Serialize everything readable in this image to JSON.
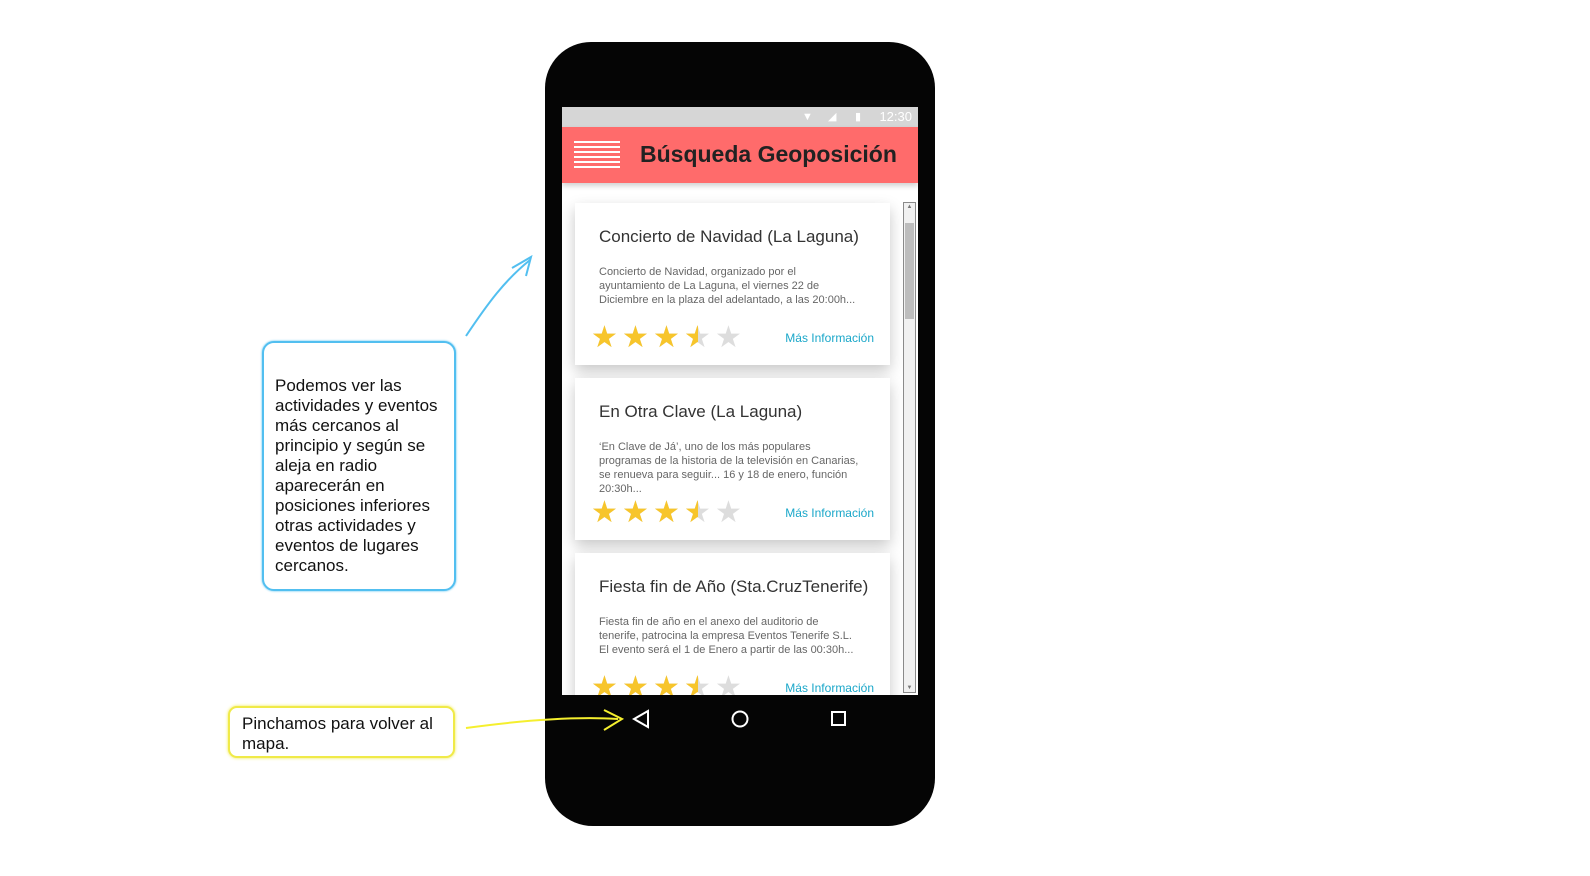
{
  "status_bar": {
    "time": "12:30",
    "icons": [
      "wifi-icon",
      "signal-icon",
      "battery-icon"
    ]
  },
  "app_bar": {
    "title": "Búsqueda Geoposición",
    "menu_icon": "hamburger-menu-icon",
    "color": "#ff6b6b"
  },
  "events": [
    {
      "title": "Concierto de Navidad (La Laguna)",
      "description": "Concierto de Navidad, organizado por el ayuntamiento de La Laguna, el viernes 22 de Diciembre en la plaza del adelantado, a las 20:00h...",
      "rating": 3.5,
      "rating_max": 5,
      "link": "Más Información"
    },
    {
      "title": "En Otra Clave (La Laguna)",
      "description": "‘En Clave de Já’, uno de los más populares programas de la historia de la televisión en Canarias, se renueva para seguir... 16 y 18 de enero, función 20:30h...",
      "rating": 3.5,
      "rating_max": 5,
      "link": "Más Información"
    },
    {
      "title": "Fiesta fin de Año (Sta.CruzTenerife)",
      "description": "Fiesta fin de año en el anexo del auditorio de tenerife, patrocina la empresa Eventos Tenerife S.L. El evento será el 1 de Enero a partir de las 00:30h...",
      "rating": 3.5,
      "rating_max": 5,
      "link": "Más Información"
    }
  ],
  "nav_bar": {
    "icons": [
      "back-triangle-icon",
      "home-circle-icon",
      "recents-square-icon"
    ]
  },
  "annotations": {
    "list_note": "Podemos ver las actividades y eventos más cercanos al principio y según se aleja en radio aparecerán en posiciones inferiores otras actividades y eventos de lugares cercanos.",
    "back_note": "Pinchamos para volver al mapa."
  },
  "colors": {
    "star": "#f7c52b",
    "star_empty": "#dddddd",
    "link": "#1aa7c9",
    "blue_callout": "#52bff0",
    "yellow_callout": "#f0ea48"
  }
}
